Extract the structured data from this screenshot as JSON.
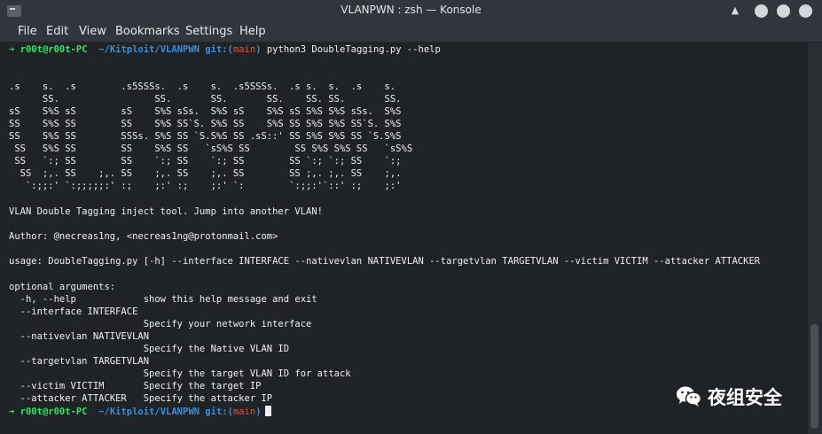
{
  "window": {
    "title": "VLANPWN : zsh — Konsole"
  },
  "menu": [
    "File",
    "Edit",
    "View",
    "Bookmarks",
    "Settings",
    "Help"
  ],
  "prompt": {
    "arrow": "➜",
    "user_host": "r00t@r00t-PC",
    "path": "~/Kitploit/VLANPWN",
    "git_label": "git:(",
    "branch": "main",
    "git_close": ")"
  },
  "command": "python3 DoubleTagging.py --help",
  "banner": [
    ".s    s.  .s        .s5SSSs.  .s    s.  .s5SSSs.  .s s.  s.  .s    s.",
    "      SS.                 SS.       SS.       SS.    SS. SS.       SS.",
    "sS    S%S sS        sS    S%S sSs.  S%S sS    S%S sS S%S S%S sSs.  S%S",
    "SS    S%S SS        SS    S%S SS`S. S%S SS    S%S SS S%S S%S SS`S. S%S",
    "SS    S%S SS        SSSs. S%S SS `S.S%S SS .sS::' SS S%S S%S SS `S.S%S",
    " SS   S%S SS        SS    S%S SS   `sS%S SS        SS S%S S%S SS   `sS%S",
    " SS   `:; SS        SS    `:; SS    `:; SS        SS `:; `:; SS    `:;",
    "  SS  ;,. SS    ;,. SS    ;,. SS    ;,. SS        SS ;,. ;,. SS    ;,.",
    "   `:;;:' `:;;;;;:' :;    ;:' :;    ;:' `:        `:;;:'`::' :;    ;:'"
  ],
  "description": "VLAN Double Tagging inject tool. Jump into another VLAN!",
  "author": "Author: @necreas1ng, <necreas1ng@protonmail.com>",
  "usage": "usage: DoubleTagging.py [-h] --interface INTERFACE --nativevlan NATIVEVLAN --targetvlan TARGETVLAN --victim VICTIM --attacker ATTACKER",
  "optional_header": "optional arguments:",
  "args": [
    "  -h, --help            show this help message and exit",
    "  --interface INTERFACE",
    "                        Specify your network interface",
    "  --nativevlan NATIVEVLAN",
    "                        Specify the Native VLAN ID",
    "  --targetvlan TARGETVLAN",
    "                        Specify the target VLAN ID for attack",
    "  --victim VICTIM       Specify the target IP",
    "  --attacker ATTACKER   Specify the attacker IP"
  ],
  "watermark": {
    "text": "夜组安全",
    "icon": "wechat-icon"
  }
}
